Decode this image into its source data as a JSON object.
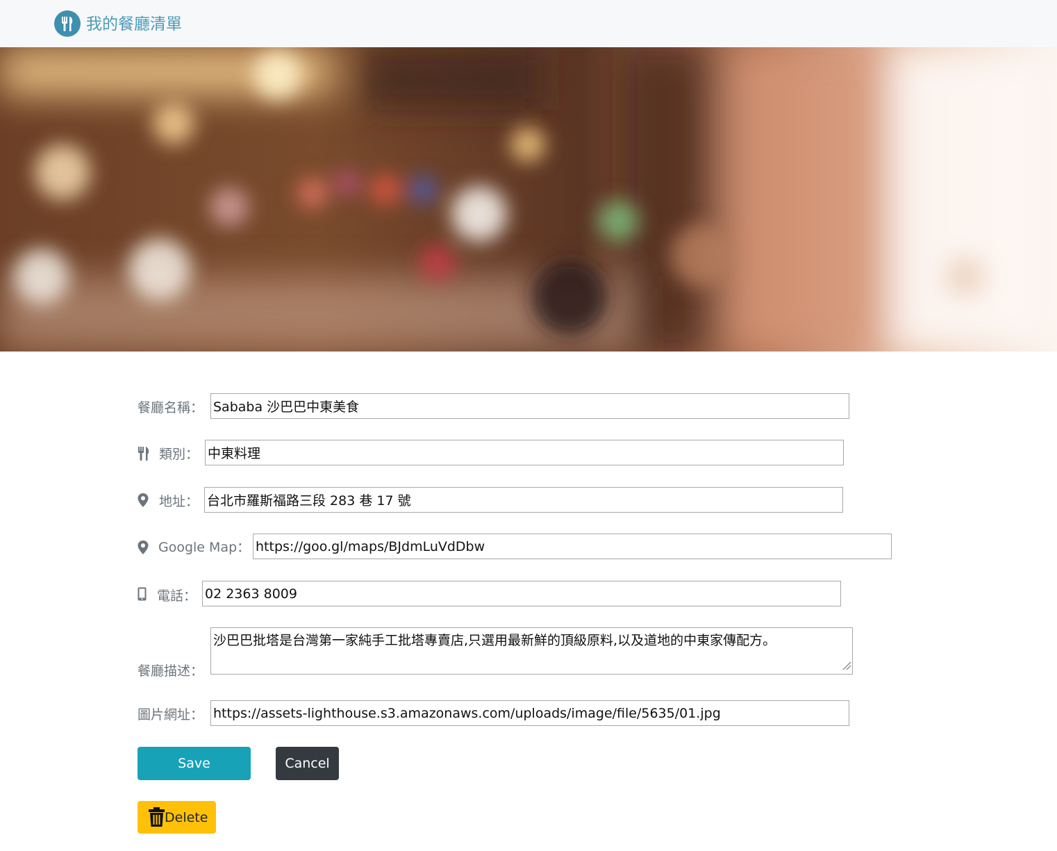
{
  "navbar": {
    "brand_icon": "utensils-icon",
    "title": "我的餐廳清單"
  },
  "banner": {
    "description": "blurred restaurant interior photo"
  },
  "form": {
    "name": {
      "label": "餐廳名稱：",
      "value": "Sababa 沙巴巴中東美食"
    },
    "category": {
      "icon": "utensils-icon",
      "label": "類別：",
      "value": "中東料理"
    },
    "location": {
      "icon": "map-marker-icon",
      "label": "地址：",
      "value": "台北市羅斯福路三段 283 巷 17 號"
    },
    "google_map": {
      "icon": "map-marker-icon",
      "label": "Google Map：",
      "value": "https://goo.gl/maps/BJdmLuVdDbw"
    },
    "phone": {
      "icon": "mobile-phone-icon",
      "label": "電話：",
      "value": "02 2363 8009"
    },
    "description": {
      "label": "餐廳描述：",
      "value": "沙巴巴批塔是台灣第一家純手工批塔專賣店,只選用最新鮮的頂級原料,以及道地的中東家傳配方。"
    },
    "image": {
      "label": "圖片網址：",
      "value": "https://assets-lighthouse.s3.amazonaws.com/uploads/image/file/5635/01.jpg"
    }
  },
  "buttons": {
    "save": "Save",
    "cancel": "Cancel",
    "delete": "Delete",
    "delete_icon": "trash-icon"
  },
  "colors": {
    "brand": "#4a9bb8",
    "save": "#17a2b8",
    "cancel": "#343a40",
    "delete": "#ffc107",
    "label": "#6c757d"
  }
}
